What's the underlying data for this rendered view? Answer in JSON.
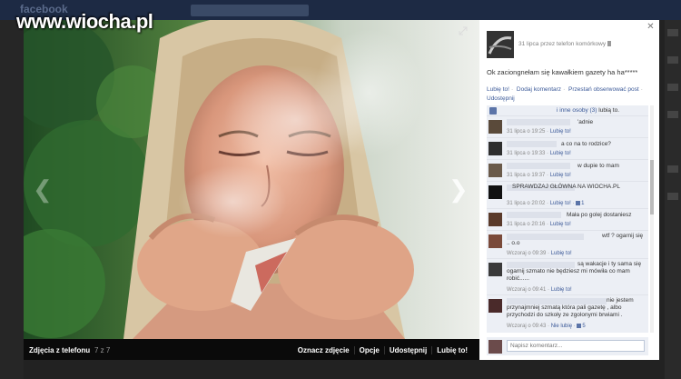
{
  "watermark": "www.wiocha.pl",
  "background": {
    "brand": "facebook"
  },
  "photo": {
    "alt_subject": "girl smoking rolled newspaper",
    "album_title": "Zdjęcia z telefonu",
    "count": "7 z 7",
    "actions": [
      "Oznacz zdjęcie",
      "Opcje",
      "Udostępnij",
      "Lubię to!"
    ]
  },
  "post": {
    "meta": "31 lipca przez telefon komórkowy",
    "caption": "Ok zaciongnełam się kawałkiem gazety ha ha*****",
    "actions": [
      "Lubię to!",
      "Dodaj komentarz",
      "Przestań obserwować post",
      "Udostępnij"
    ],
    "likes": {
      "link": "i inne osoby (3)",
      "tail": "lubią to."
    }
  },
  "comments": [
    {
      "text": "'adnie",
      "time": "31 lipca o 19:25",
      "like": "Lubię to!",
      "count": ""
    },
    {
      "text": "a co na to rodzice?",
      "time": "31 lipca o 19:33",
      "like": "Lubię to!",
      "count": ""
    },
    {
      "text": "w dupie to mam",
      "time": "31 lipca o 19:37",
      "like": "Lubię to!",
      "count": ""
    },
    {
      "text": "SPRAWDZAJ GŁÓWNA NA WIOCHA.PL",
      "time": "31 lipca o 20:02",
      "like": "Lubię to!",
      "count": "1"
    },
    {
      "text": "Mała po golej dostaniesz",
      "time": "31 lipca o 20:16",
      "like": "Lubię to!",
      "count": ""
    },
    {
      "text": "wtf ? ogarnij się .. o.o",
      "time": "Wczoraj o 09:39",
      "like": "Lubię to!",
      "count": ""
    },
    {
      "text": "są wakacje i ty sama się ogarnij szmato nie będziesz mi mówiła co mam robić......",
      "time": "Wczoraj o 09:41",
      "like": "Lubię to!",
      "count": ""
    },
    {
      "text": "nie jestem przynajmniej szmatą która pali gazetę , albo przychodzi do szkoły ze zgolonymi brwiami .",
      "time": "Wczoraj o 09:43",
      "like": "Nie lubię",
      "count": "5"
    }
  ],
  "composer": {
    "placeholder": "Napisz komentarz..."
  },
  "colors": {
    "link": "#3b5998",
    "panel_bg": "#ffffff",
    "feedback_bg": "#eceff5"
  }
}
